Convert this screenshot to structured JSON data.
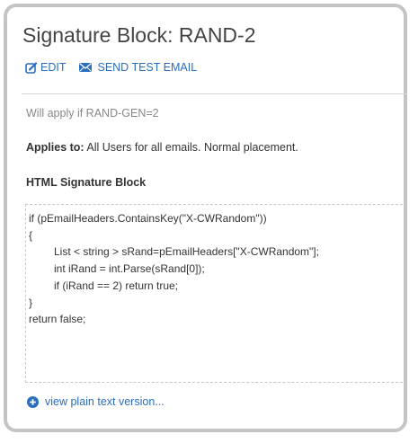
{
  "header": {
    "title": "Signature Block: RAND-2"
  },
  "actions": {
    "edit_label": "EDIT",
    "send_test_label": "SEND TEST EMAIL"
  },
  "details": {
    "condition_text": "Will apply if RAND-GEN=2",
    "applies_label": "Applies to:",
    "applies_value": "All Users for all emails. Normal placement."
  },
  "signature": {
    "section_title": "HTML Signature Block",
    "code_lines": [
      "if (pEmailHeaders.ContainsKey(\"X-CWRandom\"))",
      "{",
      "List < string > sRand=pEmailHeaders[\"X-CWRandom\"];",
      "int iRand = int.Parse(sRand[0]);",
      "if (iRand == 2) return true;",
      "}",
      "return false;"
    ]
  },
  "footer": {
    "plain_text_link": "view plain text version..."
  },
  "icons": {
    "edit": "edit-icon",
    "mail": "envelope-icon",
    "plus": "plus-circle-icon"
  },
  "colors": {
    "link": "#2a6ebb",
    "border": "#c4c4c4",
    "muted_text": "#888888"
  }
}
